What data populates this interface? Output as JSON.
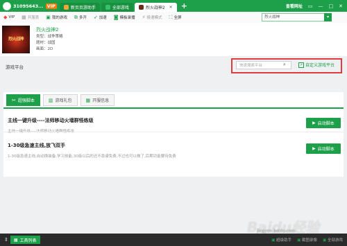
{
  "topbar": {
    "account": "31095643...",
    "vip_badge": "VIP",
    "tabs": [
      {
        "label": "新页页游助手",
        "active": false
      },
      {
        "label": "全部游戏",
        "active": false
      },
      {
        "label": "烈火战神2",
        "active": true
      }
    ],
    "plus": "+",
    "official_site": "查看网址",
    "win_buttons": [
      "▭",
      "—",
      "□",
      "✕"
    ]
  },
  "toolbar": {
    "vip": "VIP",
    "opening": "开服表",
    "my_games": "我的游戏",
    "multi_open": "多开",
    "speed_up": "加速",
    "boss_record": "模板录播",
    "minimal_mode": "极速模式",
    "fullscreen": "全屏",
    "search_value": "烈火战神"
  },
  "game": {
    "cover_text": "烈火战神",
    "name": "烈火战神2",
    "type": "类型：战争策略",
    "theme": "题材：战国",
    "frame": "画面：2D"
  },
  "platform": {
    "title": "游戏平台",
    "search_placeholder": "快速搜索平台",
    "custom_label": "自定义游戏平台"
  },
  "content_tabs": [
    {
      "label": "超强脚本",
      "active": true,
      "icon": "tools-icon"
    },
    {
      "label": "游戏礼包",
      "active": false,
      "icon": "gift-icon"
    },
    {
      "label": "开服信息",
      "active": false,
      "icon": "calendar-icon"
    }
  ],
  "scripts": [
    {
      "name": "主线一键升级----法师移动火墙群怪练级",
      "desc": "主线一键升级----法师移动火墙群怪练级",
      "button": "启动脚本"
    },
    {
      "name": "1-30级急速主线,放飞双手",
      "desc": "1-30级急速主线,自动换装备,学习技能,30级以后的还不靠谱免费,不过也可以做了,后期功能要待免费",
      "button": "启动脚本"
    }
  ],
  "statusbar": {
    "toolbox": "工具列表",
    "items": [
      "超级助手",
      "截图录像",
      "全部游戏"
    ]
  },
  "watermark": {
    "main": "Baidu经验",
    "url": "jingyan.baidu.com"
  },
  "colors": {
    "accent": "#1ea04a",
    "highlight": "#e23b3b"
  }
}
